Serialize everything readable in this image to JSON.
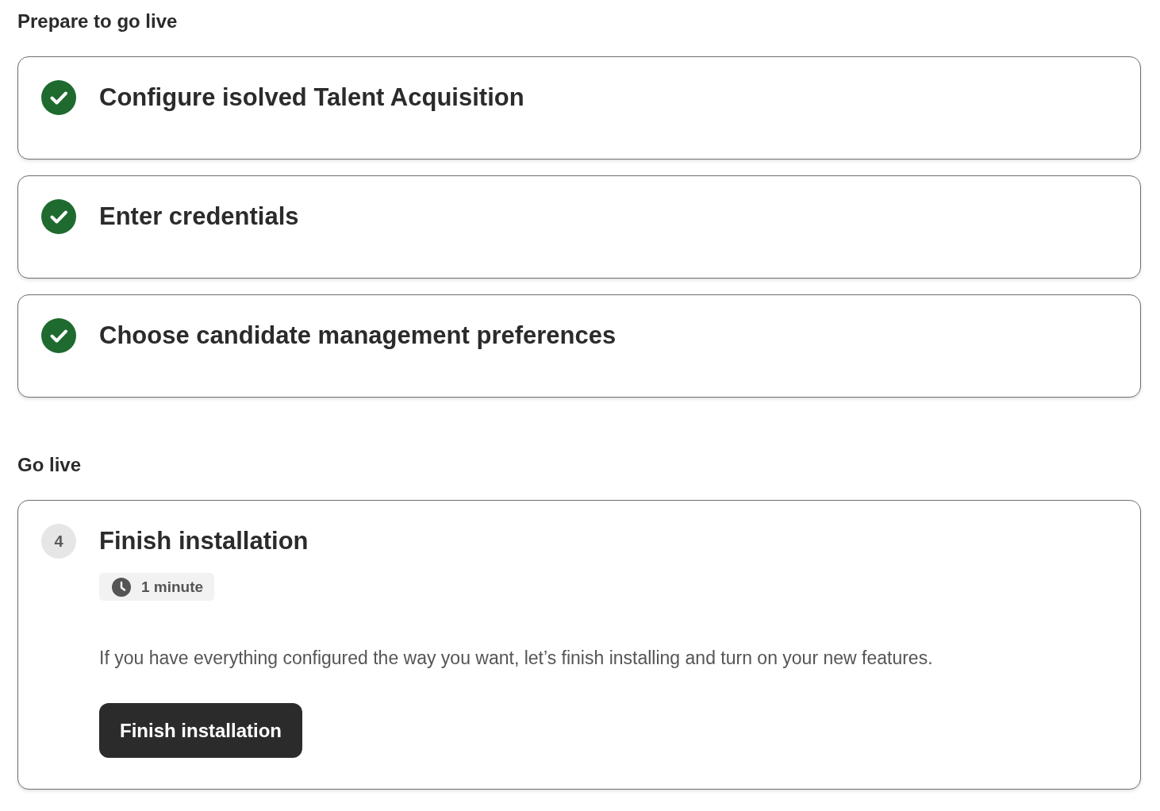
{
  "sections": [
    {
      "heading": "Prepare to go live",
      "steps": [
        {
          "title": "Configure isolved Talent Acquisition",
          "completed": true
        },
        {
          "title": "Enter credentials",
          "completed": true
        },
        {
          "title": "Choose candidate management preferences",
          "completed": true
        }
      ]
    },
    {
      "heading": "Go live",
      "steps": [
        {
          "number": "4",
          "title": "Finish installation",
          "completed": false,
          "duration": "1 minute",
          "description": "If you have everything configured the way you want, let’s finish installing and turn on your new features.",
          "button": "Finish installation"
        }
      ]
    }
  ]
}
